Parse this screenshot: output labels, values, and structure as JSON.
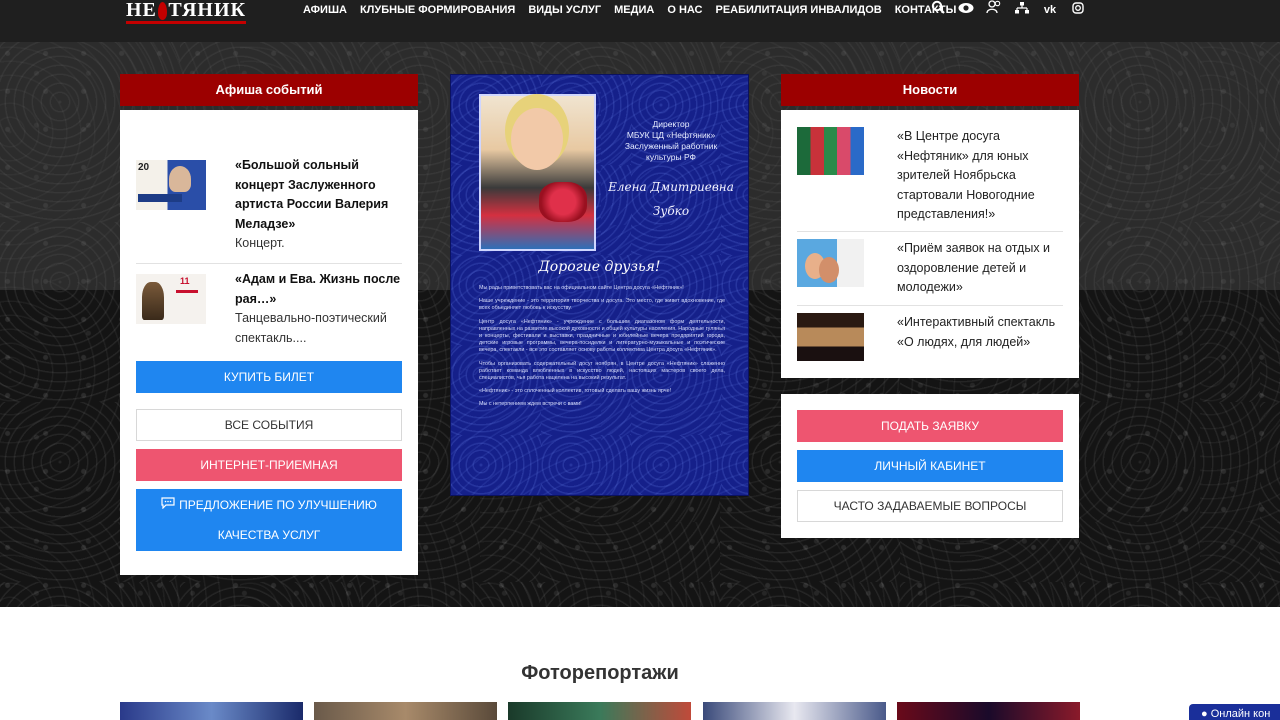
{
  "logo": {
    "text_left": "НЕ",
    "text_right": "ТЯНИК"
  },
  "nav": {
    "items": [
      "АФИША",
      "КЛУБНЫЕ ФОРМИРОВАНИЯ",
      "ВИДЫ УСЛУГ",
      "МЕДИА",
      "О НАС",
      "РЕАБИЛИТАЦИЯ ИНВАЛИДОВ",
      "КОНТАКТЫ"
    ],
    "icons": [
      "search-icon",
      "eye-icon",
      "users-icon",
      "sitemap-icon",
      "vk-icon",
      "instagram-icon"
    ]
  },
  "events": {
    "title": "Афиша событий",
    "items": [
      {
        "title": "«Большой сольный концерт Заслуженного артиста России Валерия Меладзе»",
        "desc": "Концерт."
      },
      {
        "title": "«Адам и Ева. Жизнь после рая…»",
        "desc": "Танцевально-поэтический спектакль...."
      }
    ],
    "buy_label": "КУПИТЬ БИЛЕТ",
    "all_label": "ВСЕ СОБЫТИЯ",
    "reception_label": "ИНТЕРНЕТ-ПРИЕМНАЯ",
    "suggest_line1": "ПРЕДЛОЖЕНИЕ ПО УЛУЧШЕНИЮ",
    "suggest_line2": "КАЧЕСТВА УСЛУГ"
  },
  "poster": {
    "title_lines": [
      "Директор",
      "МБУК ЦД «Нефтяник»",
      "Заслуженный работник",
      "культуры РФ"
    ],
    "signature_lines": [
      "Елена Дмитриевна",
      "Зубко"
    ],
    "greeting": "Дорогие друзья!",
    "paragraphs": [
      "Мы рады приветствовать вас на официальном сайте Центра досуга «Нефтяник»!",
      "Наше учреждение - это территория творчества и досуга. Это место, где живет вдохновение, где всех объединяет любовь к искусству.",
      "Центр досуга «Нефтяник» - учреждение с большим диапазоном форм деятельности, направленных на развитие высокой духовности и общей культуры населения. Народные гулянья и концерты, фестивали и выставки, праздничные и юбилейные вечера предприятий города, детские игровые программы, вечера-посиделки и литературно-музыкальные и поэтические вечера, спектакли - все это составляет основу работы коллектива Центра досуга «Нефтяник».",
      "Чтобы организовать содержательный досуг ноябрян, в Центре досуга «Нефтяник» слаженно работает команда влюбленных в искусство людей, настоящих мастеров своего дела, специалистов, чья работа нацелена на высокий результат.",
      "«Нефтяник» - это сплоченный коллектив, готовый сделать вашу жизнь ярче!",
      "Мы с нетерпением ждем встречи с вами!"
    ]
  },
  "news": {
    "title": "Новости",
    "items": [
      "«В Центре досуга «Нефтяник» для юных зрителей Ноябрьска стартовали Новогодние представления!»",
      "«Приём заявок на отдых и оздоровление детей и молодежи»",
      "«Интерактивный спектакль «О людях, для людей»"
    ]
  },
  "actions": {
    "apply_label": "ПОДАТЬ ЗАЯВКУ",
    "cabinet_label": "ЛИЧНЫЙ КАБИНЕТ",
    "faq_label": "ЧАСТО ЗАДАВАЕМЫЕ ВОПРОСЫ"
  },
  "photoreports": {
    "title": "Фоторепортажи"
  },
  "online": {
    "label": "Онлайн кон"
  },
  "colors": {
    "accent_red": "#9c0000",
    "button_blue": "#1f86f0",
    "button_pink": "#ee5570",
    "poster_blue": "#15208a"
  }
}
